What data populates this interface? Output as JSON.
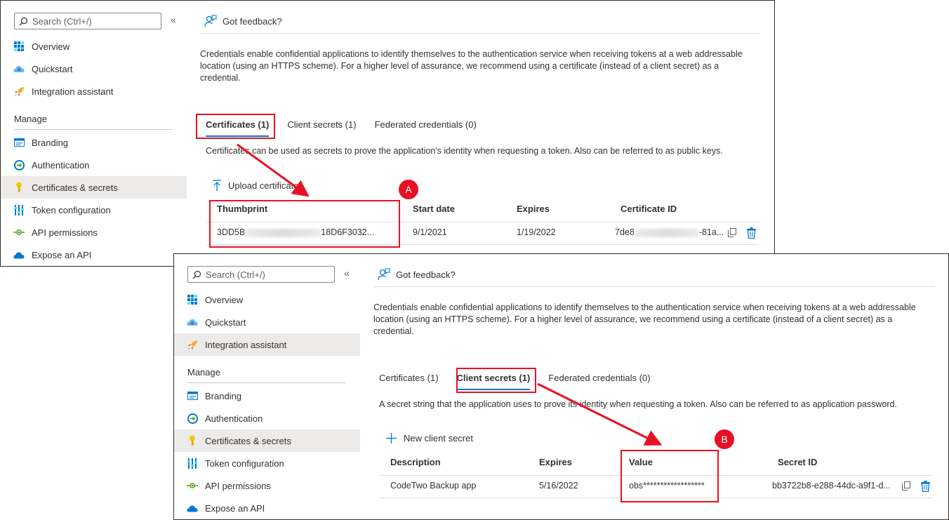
{
  "sidebar": {
    "search_placeholder": "Search (Ctrl+/)",
    "collapse_glyph": "«",
    "manage_label": "Manage",
    "top_items": [
      {
        "label": "Overview",
        "icon": "overview-grid-icon"
      },
      {
        "label": "Quickstart",
        "icon": "quickstart-cloud-icon"
      },
      {
        "label": "Integration assistant",
        "icon": "rocket-icon"
      }
    ],
    "manage_items": [
      {
        "label": "Branding",
        "icon": "branding-icon"
      },
      {
        "label": "Authentication",
        "icon": "authentication-icon"
      },
      {
        "label": "Certificates & secrets",
        "icon": "key-icon"
      },
      {
        "label": "Token configuration",
        "icon": "token-config-icon"
      },
      {
        "label": "API permissions",
        "icon": "api-permissions-icon"
      },
      {
        "label": "Expose an API",
        "icon": "expose-api-cloud-icon"
      }
    ]
  },
  "header": {
    "feedback_label": "Got feedback?"
  },
  "description": "Credentials enable confidential applications to identify themselves to the authentication service when receiving tokens at a web addressable location (using an HTTPS scheme). For a higher level of assurance, we recommend using a certificate (instead of a client secret) as a credential.",
  "tabs": {
    "certificates": "Certificates (1)",
    "client_secrets": "Client secrets (1)",
    "federated": "Federated credentials (0)"
  },
  "certificates_view": {
    "tab_description": "Certificates can be used as secrets to prove the application's identity when requesting a token. Also can be referred to as public keys.",
    "action_label": "Upload certificate",
    "columns": [
      "Thumbprint",
      "Start date",
      "Expires",
      "Certificate ID"
    ],
    "row": {
      "thumbprint_start": "3DD5B",
      "thumbprint_end": "18D6F3032...",
      "start_date": "9/1/2021",
      "expires": "1/19/2022",
      "id_start": "7de8",
      "id_end": "-81a..."
    },
    "callout": "A"
  },
  "secrets_view": {
    "tab_description": "A secret string that the application uses to prove its identity when requesting a token. Also can be referred to as application password.",
    "action_label": "New client secret",
    "columns": [
      "Description",
      "Expires",
      "Value",
      "Secret ID"
    ],
    "row": {
      "description": "CodeTwo Backup app",
      "expires": "5/16/2022",
      "value": "obs******************",
      "secret_id": "bb3722b8-e288-44dc-a9f1-d..."
    },
    "callout": "B"
  },
  "colors": {
    "accent": "#0078d4",
    "callout_red": "#e81123",
    "selected_bg": "#edebe9",
    "text": "#323130"
  }
}
